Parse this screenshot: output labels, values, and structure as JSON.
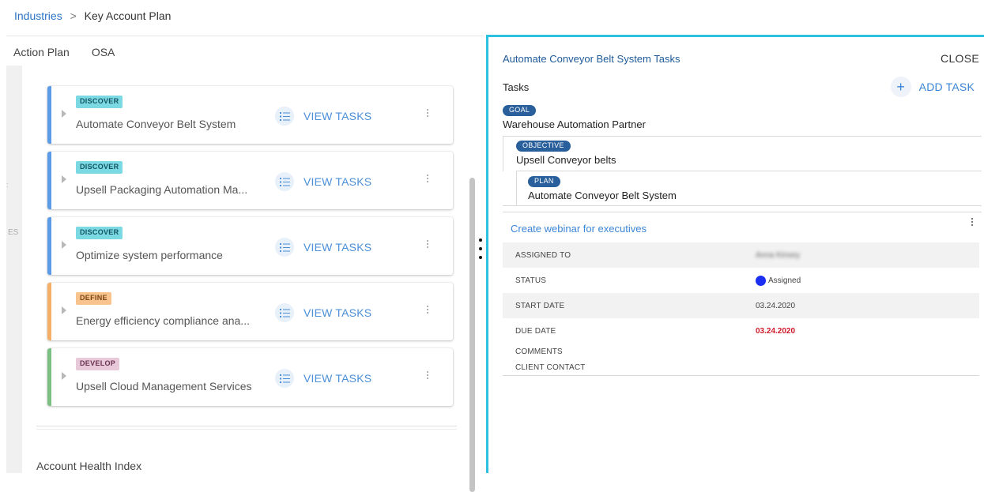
{
  "breadcrumb": {
    "parent": "Industries",
    "separator": ">",
    "current": "Key Account Plan"
  },
  "left": {
    "tabs": [
      "Action Plan",
      "OSA"
    ],
    "strip_text": "ES",
    "view_tasks_label": "VIEW TASKS",
    "cards": [
      {
        "stage": "DISCOVER",
        "title": "Automate Conveyor Belt System"
      },
      {
        "stage": "DISCOVER",
        "title": "Upsell Packaging Automation Ma..."
      },
      {
        "stage": "DISCOVER",
        "title": "Optimize system performance"
      },
      {
        "stage": "DEFINE",
        "title": "Energy efficiency compliance ana..."
      },
      {
        "stage": "DEVELOP",
        "title": "Upsell Cloud Management Services"
      }
    ],
    "section_title": "Account Health Index"
  },
  "right": {
    "title": "Automate Conveyor Belt System Tasks",
    "close_label": "CLOSE",
    "tasks_label": "Tasks",
    "add_task_label": "ADD TASK",
    "hierarchy": {
      "goal": {
        "tag": "GOAL",
        "name": "Warehouse Automation Partner"
      },
      "objective": {
        "tag": "OBJECTIVE",
        "name": "Upsell Conveyor belts"
      },
      "plan": {
        "tag": "PLAN",
        "name": "Automate Conveyor Belt System"
      }
    },
    "task": {
      "name": "Create webinar for executives",
      "fields": {
        "assigned_to": {
          "label": "ASSIGNED TO",
          "value": "Anna Kinsey"
        },
        "status": {
          "label": "STATUS",
          "value": "Assigned"
        },
        "start_date": {
          "label": "START DATE",
          "value": "03.24.2020"
        },
        "due_date": {
          "label": "DUE DATE",
          "value": "03.24.2020"
        },
        "comments": {
          "label": "COMMENTS",
          "value": ""
        },
        "client_contact": {
          "label": "CLIENT CONTACT",
          "value": ""
        }
      }
    }
  },
  "colors": {
    "accent": "#2dc1e0",
    "link": "#3c86d6",
    "discover": "#5b9be8",
    "define": "#f4b067",
    "develop": "#7bbf83",
    "due_date": "#d0192a",
    "status_assigned": "#1b2ff0"
  }
}
